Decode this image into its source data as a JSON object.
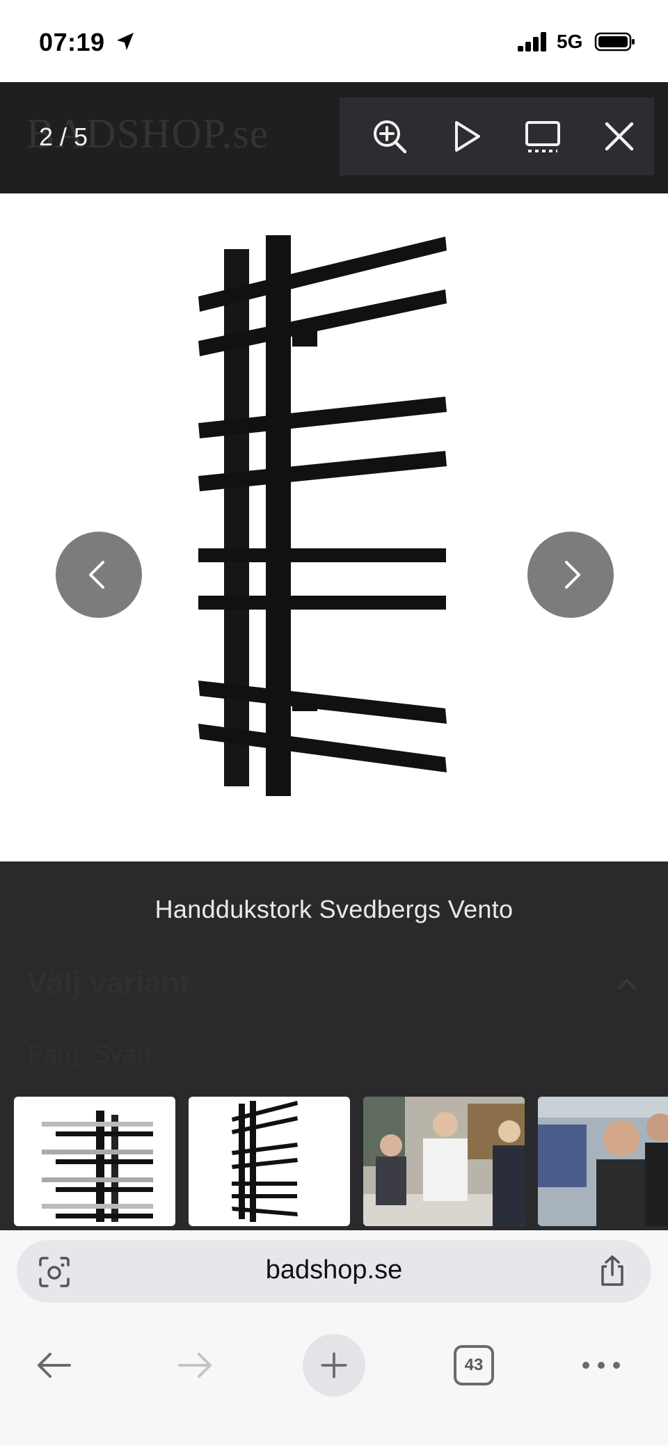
{
  "status_bar": {
    "time": "07:19",
    "network": "5G",
    "location_icon": "location-arrow-icon",
    "signal_icon": "signal-bars-icon",
    "battery_icon": "battery-icon"
  },
  "lightbox": {
    "counter": "2 / 5",
    "background_logo": "BADSHOP.se",
    "tools": [
      {
        "name": "zoom-in-icon"
      },
      {
        "name": "play-icon"
      },
      {
        "name": "fullscreen-icon"
      },
      {
        "name": "close-icon"
      }
    ],
    "caption": "Handdukstork Svedbergs Vento",
    "prev_icon": "chevron-left-icon",
    "next_icon": "chevron-right-icon",
    "thumbnails": [
      {
        "kind": "product",
        "label": "Towel rail front view"
      },
      {
        "kind": "product",
        "label": "Towel rail angled view"
      },
      {
        "kind": "photo",
        "label": "Factory team photo"
      },
      {
        "kind": "photo",
        "label": "Factory worker photo"
      }
    ]
  },
  "background_page": {
    "variant_title": "Välj variant",
    "color_label": "Färg: Svart"
  },
  "browser": {
    "url": "badshop.se",
    "tab_count": "43",
    "icons": {
      "scan": "camera-scan-icon",
      "share": "share-icon",
      "back": "back-arrow-icon",
      "forward": "forward-arrow-icon",
      "new_tab": "plus-icon",
      "tabs": "tabs-icon",
      "more": "more-icon"
    }
  },
  "colors": {
    "overlay_bg": "#2a2a2d",
    "toolbar_bg": "#2d2d31",
    "nav_button": "#7c7c7c",
    "product": "#111111"
  }
}
